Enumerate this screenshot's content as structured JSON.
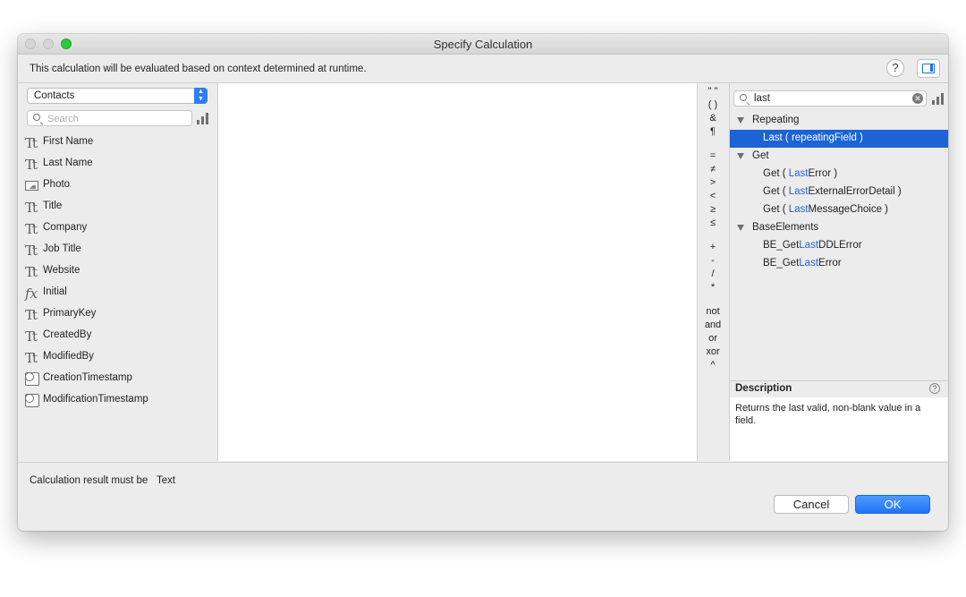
{
  "window": {
    "title": "Specify Calculation",
    "info_text": "This calculation will be evaluated based on context determined at runtime.",
    "help_label": "?"
  },
  "left": {
    "table_select": "Contacts",
    "search_placeholder": "Search",
    "fields": [
      {
        "label": "First Name",
        "icon": "text-field-icon"
      },
      {
        "label": "Last Name",
        "icon": "text-field-icon"
      },
      {
        "label": "Photo",
        "icon": "container-field-icon"
      },
      {
        "label": "Title",
        "icon": "text-field-icon"
      },
      {
        "label": "Company",
        "icon": "text-field-icon"
      },
      {
        "label": "Job Title",
        "icon": "text-field-icon"
      },
      {
        "label": "Website",
        "icon": "text-field-icon"
      },
      {
        "label": "Initial",
        "icon": "calculation-field-icon"
      },
      {
        "label": "PrimaryKey",
        "icon": "text-field-icon"
      },
      {
        "label": "CreatedBy",
        "icon": "text-field-icon"
      },
      {
        "label": "ModifiedBy",
        "icon": "text-field-icon"
      },
      {
        "label": "CreationTimestamp",
        "icon": "timestamp-field-icon"
      },
      {
        "label": "ModificationTimestamp",
        "icon": "timestamp-field-icon"
      }
    ]
  },
  "operators": {
    "items": [
      "\" \"",
      "( )",
      "&",
      "¶",
      "=",
      "≠",
      ">",
      "<",
      "≥",
      "≤",
      "+",
      "-",
      "/",
      "*",
      "not",
      "and",
      "or",
      "xor",
      "^"
    ]
  },
  "functions": {
    "search_value": "last",
    "categories": [
      {
        "name": "Repeating",
        "items": [
          {
            "pre": "",
            "hl": "Last ( repeatingField )",
            "post": "",
            "selected": true
          }
        ]
      },
      {
        "name": "Get",
        "items": [
          {
            "pre": "Get ( ",
            "hl": "Last",
            "post": "Error )",
            "selected": false
          },
          {
            "pre": "Get ( ",
            "hl": "Last",
            "post": "ExternalErrorDetail )",
            "selected": false
          },
          {
            "pre": "Get ( ",
            "hl": "Last",
            "post": "MessageChoice )",
            "selected": false
          }
        ]
      },
      {
        "name": "BaseElements",
        "items": [
          {
            "pre": "BE_Get",
            "hl": "Last",
            "post": "DDLError",
            "selected": false
          },
          {
            "pre": "BE_Get",
            "hl": "Last",
            "post": "Error",
            "selected": false
          }
        ]
      }
    ],
    "description_title": "Description",
    "description_text": "Returns the last valid, non-blank value in a field."
  },
  "footer": {
    "result_label": "Calculation result must be",
    "result_type": "Text",
    "cancel_label": "Cancel",
    "ok_label": "OK"
  },
  "colors": {
    "accent": "#1c63d6",
    "highlight_text": "#2a63d9",
    "zoom_button": "#2ac940"
  }
}
